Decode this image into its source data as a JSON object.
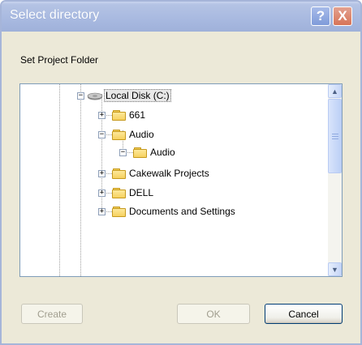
{
  "window": {
    "title": "Select directory",
    "help_label": "?",
    "close_label": "X"
  },
  "dialog": {
    "prompt": "Set Project Folder"
  },
  "tree": {
    "root": {
      "label": "Local Disk (C:)",
      "expander": "−",
      "icon": "hard-disk-icon"
    },
    "nodes": [
      {
        "label": "661",
        "expander": "+",
        "icon": "folder-icon"
      },
      {
        "label": "Audio",
        "expander": "−",
        "icon": "folder-icon"
      },
      {
        "label": "Audio",
        "expander": "−",
        "icon": "folder-icon"
      },
      {
        "label": "Cakewalk Projects",
        "expander": "+",
        "icon": "folder-icon"
      },
      {
        "label": "DELL",
        "expander": "+",
        "icon": "folder-icon"
      },
      {
        "label": "Documents and Settings",
        "expander": "+",
        "icon": "folder-icon"
      }
    ]
  },
  "scrollbar": {
    "up_icon": "▲",
    "down_icon": "▼"
  },
  "buttons": {
    "create": "Create",
    "ok": "OK",
    "cancel": "Cancel"
  },
  "colors": {
    "title_bar": "#a8b9e0",
    "close_button": "#d77457",
    "dialog_background": "#ece9d8",
    "folder": "#f6d160"
  }
}
